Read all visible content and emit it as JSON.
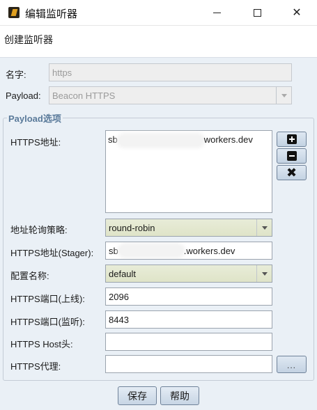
{
  "window": {
    "title": "编辑监听器",
    "icon": "app-icon",
    "controls": [
      "minimize-icon",
      "maximize-icon",
      "close-icon"
    ],
    "close_glyph": "✕"
  },
  "header": {
    "text": "创建监听器"
  },
  "form": {
    "name_label": "名字:",
    "name_value": "https",
    "payload_label": "Payload:",
    "payload_value": "Beacon HTTPS",
    "options_title": "Payload选项",
    "https_hosts_label": "HTTPS地址:",
    "https_hosts_prefix": "sb",
    "https_hosts_suffix": "workers.dev",
    "rotate_label": "地址轮询策略:",
    "rotate_value": "round-robin",
    "stager_label": "HTTPS地址(Stager):",
    "stager_prefix": "sb",
    "stager_suffix": ".workers.dev",
    "profile_label": "配置名称:",
    "profile_value": "default",
    "port_bind_label": "HTTPS端口(上线):",
    "port_bind_value": "2096",
    "port_listen_label": "HTTPS端口(监听):",
    "port_listen_value": "8443",
    "host_header_label": "HTTPS Host头:",
    "host_header_value": "",
    "proxy_label": "HTTPS代理:",
    "proxy_value": "",
    "proxy_button": "..."
  },
  "side_buttons": [
    "plus-icon",
    "minus-icon",
    "x-icon"
  ],
  "buttons": {
    "save": "保存",
    "help": "帮助"
  }
}
